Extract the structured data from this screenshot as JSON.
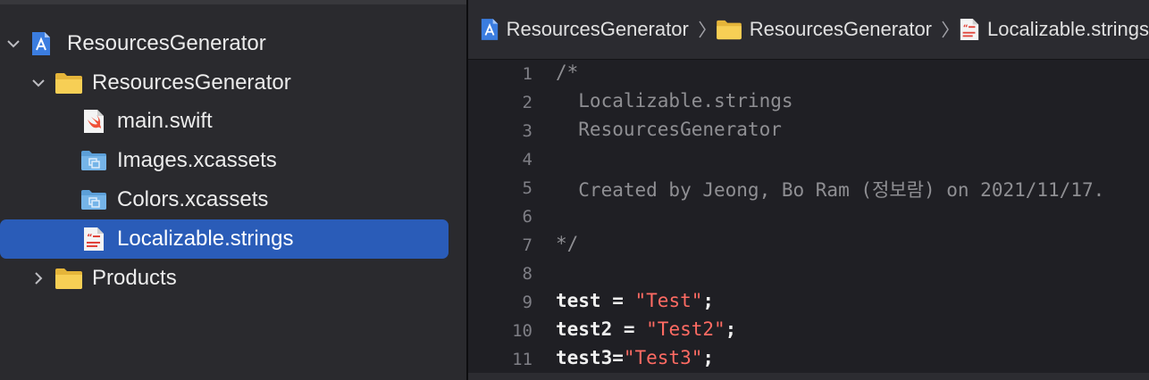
{
  "navigator": {
    "items": [
      {
        "label": "ResourcesGenerator",
        "icon": "xcode-project-icon",
        "disclosure": "expanded"
      },
      {
        "label": "ResourcesGenerator",
        "icon": "folder-icon",
        "disclosure": "expanded"
      },
      {
        "label": "main.swift",
        "icon": "swift-file-icon"
      },
      {
        "label": "Images.xcassets",
        "icon": "asset-catalog-icon"
      },
      {
        "label": "Colors.xcassets",
        "icon": "asset-catalog-icon"
      },
      {
        "label": "Localizable.strings",
        "icon": "strings-file-icon",
        "selected": true
      },
      {
        "label": "Products",
        "icon": "folder-icon",
        "disclosure": "collapsed"
      }
    ]
  },
  "jumpbar": {
    "crumbs": [
      "ResourcesGenerator",
      "ResourcesGenerator",
      "Localizable.strings"
    ]
  },
  "editor": {
    "lines": [
      {
        "num": "1",
        "text": "/*"
      },
      {
        "num": "2",
        "text": "  Localizable.strings"
      },
      {
        "num": "3",
        "text": "  ResourcesGenerator"
      },
      {
        "num": "4",
        "text": ""
      },
      {
        "num": "5",
        "text": "  Created by Jeong, Bo Ram (정보람) on 2021/11/17."
      },
      {
        "num": "6",
        "text": ""
      },
      {
        "num": "7",
        "text": "*/"
      },
      {
        "num": "8",
        "text": ""
      },
      {
        "num": "9",
        "key": "test = ",
        "value": "\"Test\"",
        "end": ";"
      },
      {
        "num": "10",
        "key": "test2 = ",
        "value": "\"Test2\"",
        "end": ";"
      },
      {
        "num": "11",
        "key": "test3=",
        "value": "\"Test3\"",
        "end": ";"
      }
    ]
  },
  "colors": {
    "selection": "#2a5cb8",
    "string": "#ff6b63",
    "comment": "#8f8f93",
    "folder": "#f2c94c"
  }
}
